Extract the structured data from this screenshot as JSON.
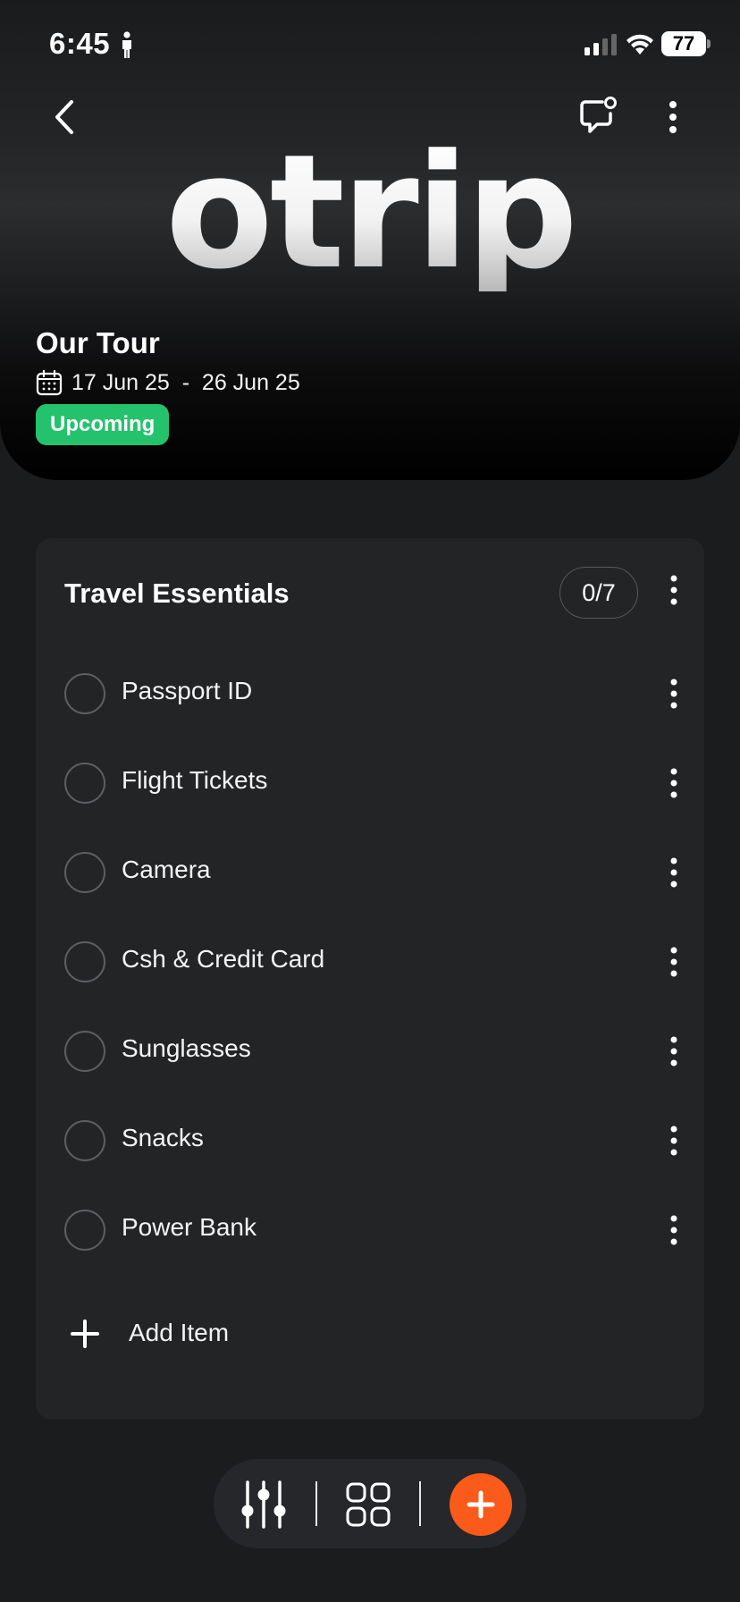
{
  "status_bar": {
    "time": "6:45",
    "battery": "77"
  },
  "header": {
    "logo_text": "otrip",
    "trip_title": "Our Tour",
    "trip_dates": "17 Jun 25  -  26 Jun 25",
    "status_badge": "Upcoming",
    "badge_color": "#25c26e"
  },
  "checklist": {
    "title": "Travel Essentials",
    "count": "0/7",
    "items": [
      {
        "label": "Passport ID"
      },
      {
        "label": "Flight Tickets"
      },
      {
        "label": "Camera"
      },
      {
        "label": "Csh & Credit Card"
      },
      {
        "label": "Sunglasses"
      },
      {
        "label": "Snacks"
      },
      {
        "label": "Power Bank"
      }
    ],
    "add_item_label": "Add Item"
  },
  "toolbar": {
    "accent_color": "#fa5a1a",
    "icons": [
      "sliders-icon",
      "grid-icon",
      "plus-icon"
    ]
  },
  "icons": [
    "back-arrow-icon",
    "chat-bubble-icon",
    "more-vertical-icon",
    "calendar-icon",
    "person-icon",
    "signal-icon",
    "wifi-icon"
  ]
}
